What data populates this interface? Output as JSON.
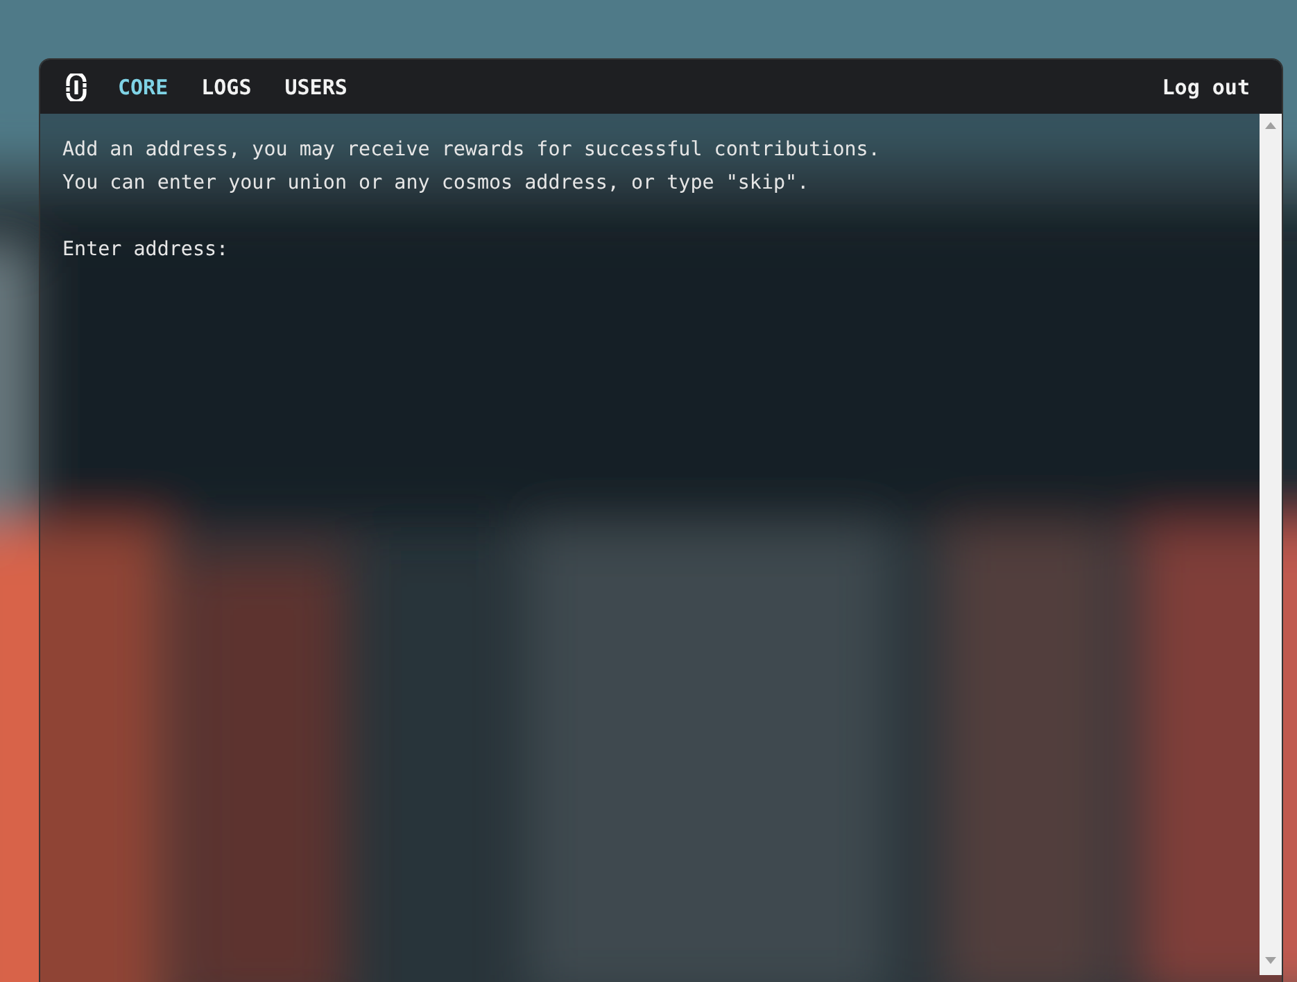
{
  "nav": {
    "tabs": [
      {
        "label": "CORE",
        "selected": true
      },
      {
        "label": "LOGS",
        "selected": false
      },
      {
        "label": "USERS",
        "selected": false
      }
    ],
    "logout": "Log out"
  },
  "terminal": {
    "message": [
      "Add an address, you may receive rewards for successful contributions.",
      "You can enter your union or any cosmos address, or type \"skip\"."
    ],
    "prompt": "Enter address:"
  }
}
